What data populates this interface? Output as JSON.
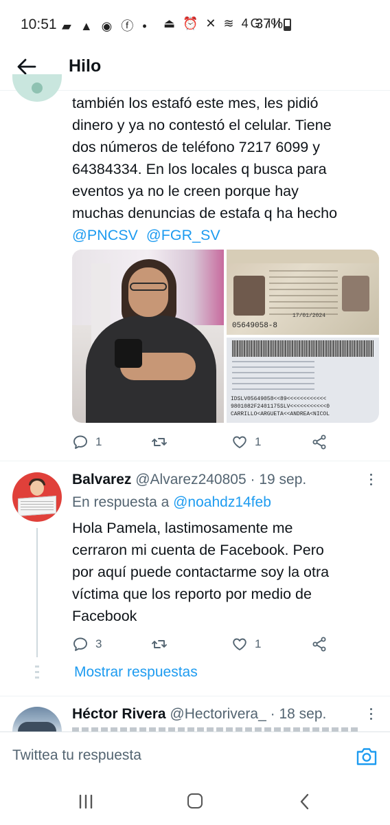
{
  "status_bar": {
    "time": "10:51",
    "left_icons": "▰ ▲ ◉ ⓕ •",
    "right_icons": "⏏ ⏰ ✕ ≋ 4G ıll",
    "battery": "37%"
  },
  "header": {
    "title": "Hilo"
  },
  "tweet1": {
    "lines": [
      "también los estafó este mes, les pidió",
      "dinero y ya no contestó el celular. Tiene",
      "dos números de teléfono 7217 6099 y",
      "64384334. En los locales q busca para",
      "eventos ya no le creen porque hay",
      "muchas denuncias de estafa q ha hecho"
    ],
    "mentions": [
      "@PNCSV",
      "@FGR_SV"
    ],
    "id_number": "05649058-8",
    "id_date": "17/01/2024",
    "mrz": "IDSLV05649058<<89<<<<<<<<<<<<\n9801082F2401175SLV<<<<<<<<<<<0\nCARRILLO<ARGUETA<<ANDREA<NICOL",
    "reply_count": "1",
    "retweet_count": "",
    "like_count": "1"
  },
  "tweet2": {
    "name": "Balvarez",
    "handle": "@Alvarez240805",
    "date": "· 19 sep.",
    "reply_prefix": "En respuesta a",
    "reply_handle": "@noahdz14feb",
    "lines": [
      "Hola Pamela, lastimosamente me",
      "cerraron mi cuenta de Facebook. Pero",
      "por aquí puede contactarme soy la otra",
      "víctima que los reporto por medio de",
      "Facebook"
    ],
    "reply_count": "3",
    "like_count": "1",
    "show_replies": "Mostrar respuestas"
  },
  "tweet3": {
    "name": "Héctor Rivera",
    "handle": "@Hectorivera_",
    "date": "· 18 sep."
  },
  "composer": {
    "placeholder": "Twittea tu respuesta"
  },
  "colors": {
    "accent": "#1d9bf0",
    "text": "#0f1419",
    "muted": "#536471"
  }
}
